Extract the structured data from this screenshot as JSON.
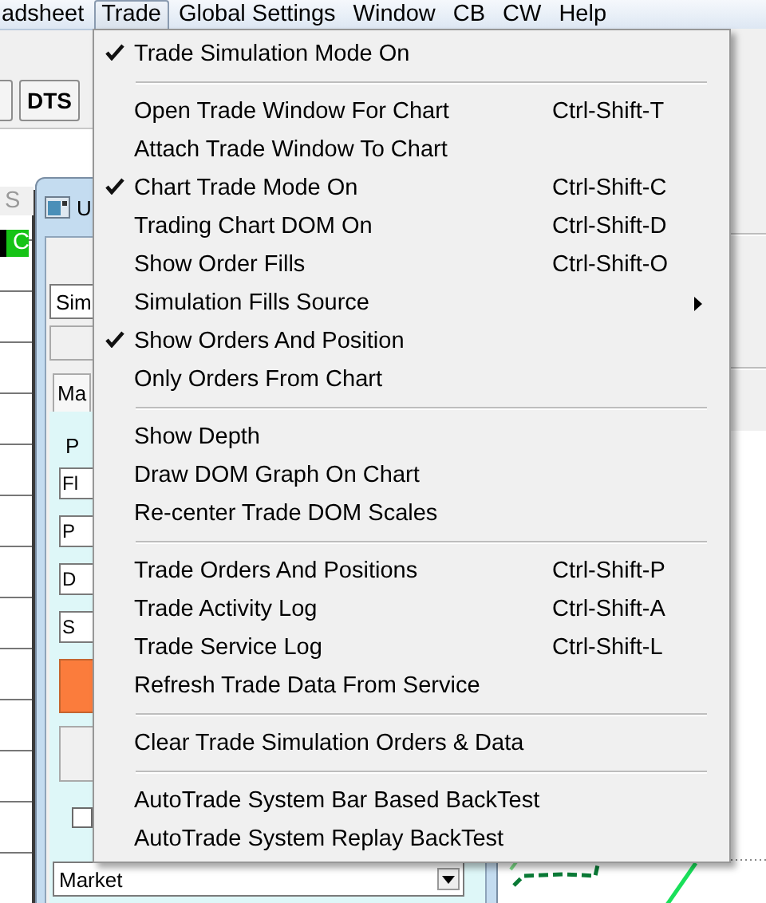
{
  "menu_bar": [
    {
      "label": "adsheet",
      "selected": false
    },
    {
      "label": "Trade",
      "selected": true
    },
    {
      "label": "Global Settings",
      "selected": false
    },
    {
      "label": "Window",
      "selected": false
    },
    {
      "label": "CB",
      "selected": false
    },
    {
      "label": "CW",
      "selected": false
    },
    {
      "label": "Help",
      "selected": false
    }
  ],
  "toolbar": {
    "buttons": [
      "DTS"
    ]
  },
  "side_panel": {
    "tab": "S",
    "cell": "C"
  },
  "child_window": {
    "title": "U",
    "source_field": "Sim",
    "tab": "Ma",
    "group_label": "P",
    "fields": [
      "Fl",
      "P",
      "D",
      "S"
    ],
    "order_checkbox": {
      "checked": false
    },
    "order_type": "Market"
  },
  "trade_menu": {
    "items": [
      {
        "kind": "item",
        "label": "Trade Simulation Mode On",
        "checked": true
      },
      {
        "kind": "separator"
      },
      {
        "kind": "item",
        "label": "Open Trade Window For Chart",
        "checked": false,
        "shortcut": "Ctrl-Shift-T"
      },
      {
        "kind": "item",
        "label": "Attach Trade Window To Chart",
        "checked": false
      },
      {
        "kind": "item",
        "label": "Chart Trade Mode On",
        "checked": true,
        "shortcut": "Ctrl-Shift-C"
      },
      {
        "kind": "item",
        "label": "Trading Chart DOM On",
        "checked": false,
        "shortcut": "Ctrl-Shift-D"
      },
      {
        "kind": "item",
        "label": "Show Order Fills",
        "checked": false,
        "shortcut": "Ctrl-Shift-O"
      },
      {
        "kind": "item",
        "label": "Simulation Fills Source",
        "checked": false,
        "submenu": true
      },
      {
        "kind": "item",
        "label": "Show Orders And Position",
        "checked": true
      },
      {
        "kind": "item",
        "label": "Only Orders From Chart",
        "checked": false
      },
      {
        "kind": "separator"
      },
      {
        "kind": "item",
        "label": "Show Depth",
        "checked": false
      },
      {
        "kind": "item",
        "label": "Draw DOM Graph On Chart",
        "checked": false
      },
      {
        "kind": "item",
        "label": "Re-center Trade DOM Scales",
        "checked": false
      },
      {
        "kind": "separator"
      },
      {
        "kind": "item",
        "label": "Trade Orders And Positions",
        "checked": false,
        "shortcut": "Ctrl-Shift-P"
      },
      {
        "kind": "item",
        "label": "Trade Activity Log",
        "checked": false,
        "shortcut": "Ctrl-Shift-A"
      },
      {
        "kind": "item",
        "label": "Trade Service Log",
        "checked": false,
        "shortcut": "Ctrl-Shift-L"
      },
      {
        "kind": "item",
        "label": "Refresh Trade Data From Service",
        "checked": false
      },
      {
        "kind": "separator"
      },
      {
        "kind": "item",
        "label": "Clear Trade Simulation Orders & Data",
        "checked": false
      },
      {
        "kind": "separator"
      },
      {
        "kind": "item",
        "label": "AutoTrade System Bar Based BackTest",
        "checked": false
      },
      {
        "kind": "item",
        "label": "AutoTrade System Replay BackTest",
        "checked": false
      }
    ]
  }
}
